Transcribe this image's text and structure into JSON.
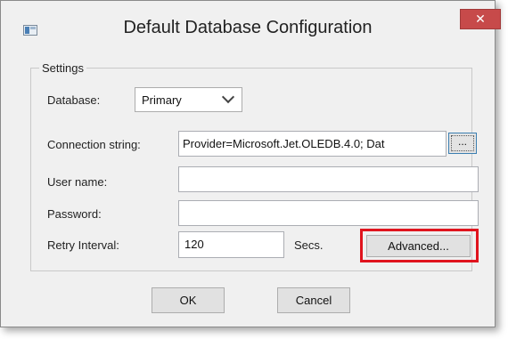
{
  "window": {
    "title": "Default Database Configuration",
    "close_glyph": "✕"
  },
  "settings": {
    "group_label": "Settings",
    "database": {
      "label": "Database:",
      "selected": "Primary"
    },
    "connection_string": {
      "label": "Connection string:",
      "value": "Provider=Microsoft.Jet.OLEDB.4.0; Dat",
      "browse_label": "..."
    },
    "user_name": {
      "label": "User name:",
      "value": ""
    },
    "password": {
      "label": "Password:",
      "value": ""
    },
    "retry_interval": {
      "label": "Retry Interval:",
      "value": "120",
      "unit": "Secs."
    },
    "advanced_label": "Advanced..."
  },
  "buttons": {
    "ok_label": "OK",
    "cancel_label": "Cancel"
  },
  "colors": {
    "highlight": "#e0141e",
    "close_button": "#c74a4a"
  }
}
